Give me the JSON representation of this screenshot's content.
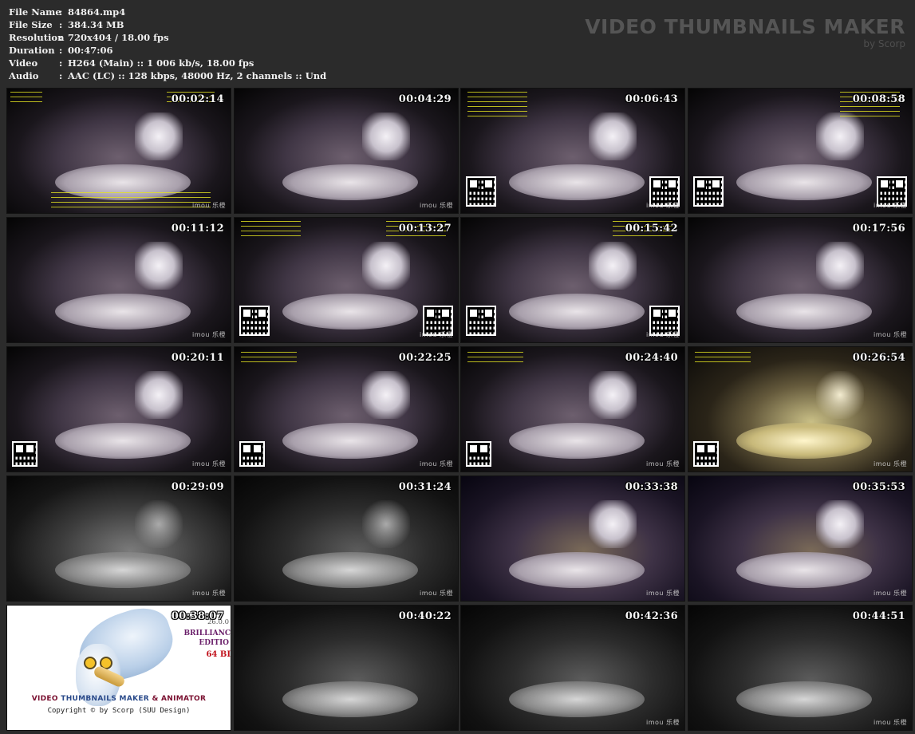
{
  "info": [
    {
      "key": "File Name",
      "value": "84864.mp4"
    },
    {
      "key": "File Size",
      "value": "384.34 MB"
    },
    {
      "key": "Resolution",
      "value": "720x404 / 18.00 fps"
    },
    {
      "key": "Duration",
      "value": "00:47:06"
    },
    {
      "key": "Video",
      "value": "H264 (Main) :: 1 006 kb/s, 18.00 fps"
    },
    {
      "key": "Audio",
      "value": "AAC (LC) :: 128 kbps, 48000 Hz, 2 channels :: Und"
    }
  ],
  "brand": {
    "title": "VIDEO THUMBNAILS MAKER",
    "subtitle": "by Scorp"
  },
  "colon": ":",
  "thumbs": [
    {
      "time": "00:02:14",
      "wm": "imou 乐橙"
    },
    {
      "time": "00:04:29",
      "wm": "imou 乐橙"
    },
    {
      "time": "00:06:43",
      "wm": "imou 乐橙"
    },
    {
      "time": "00:08:58",
      "wm": "imou 乐橙"
    },
    {
      "time": "00:11:12",
      "wm": "imou 乐橙"
    },
    {
      "time": "00:13:27",
      "wm": "imou 乐橙"
    },
    {
      "time": "00:15:42",
      "wm": "imou 乐橙"
    },
    {
      "time": "00:17:56",
      "wm": "imou 乐橙"
    },
    {
      "time": "00:20:11",
      "wm": "imou 乐橙"
    },
    {
      "time": "00:22:25",
      "wm": "imou 乐橙"
    },
    {
      "time": "00:24:40",
      "wm": "imou 乐橙"
    },
    {
      "time": "00:26:54",
      "wm": "imou 乐橙"
    },
    {
      "time": "00:29:09",
      "wm": "imou 乐橙"
    },
    {
      "time": "00:31:24",
      "wm": "imou 乐橙"
    },
    {
      "time": "00:33:38",
      "wm": "imou 乐橙"
    },
    {
      "time": "00:35:53",
      "wm": "imou 乐橙"
    },
    {
      "time": "00:38:07",
      "wm": ""
    },
    {
      "time": "00:40:22",
      "wm": ""
    },
    {
      "time": "00:42:36",
      "wm": "imou 乐橙"
    },
    {
      "time": "00:44:51",
      "wm": "imou 乐橙"
    }
  ],
  "logo": {
    "title_a": "VIDEO ",
    "title_b": "THUMBNAILS MAKER",
    "title_c": " & ANIMATOR",
    "copyright": "Copyright © by Scorp (SUU Design)",
    "version": "26.0.0",
    "edition1": "BRILLIANC",
    "edition2": "EDITIO",
    "bits": "64 BI"
  }
}
